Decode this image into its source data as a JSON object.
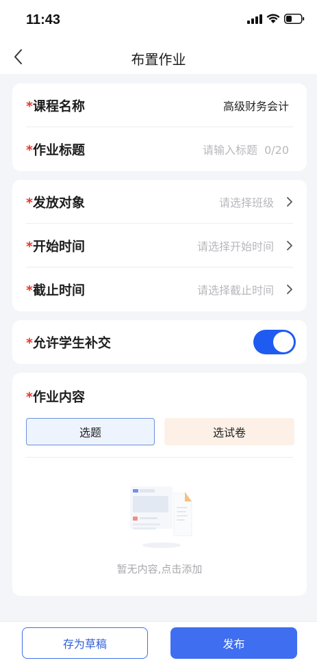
{
  "status": {
    "time": "11:43"
  },
  "nav": {
    "title": "布置作业",
    "back_icon": "chevron-left-icon"
  },
  "required_mark": "*",
  "basic": {
    "course_label": "课程名称",
    "course_value": "高级财务会计",
    "title_label": "作业标题",
    "title_placeholder": "请输入标题",
    "title_counter": "0/20"
  },
  "dispatch": {
    "target_label": "发放对象",
    "target_placeholder": "请选择班级",
    "start_label": "开始时间",
    "start_placeholder": "请选择开始时间",
    "end_label": "截止时间",
    "end_placeholder": "请选择截止时间"
  },
  "late": {
    "label": "允许学生补交",
    "enabled": true
  },
  "content": {
    "label": "作业内容",
    "tabs": [
      "选题",
      "选试卷"
    ],
    "selected_tab": "选题",
    "empty_text": "暂无内容,点击添加"
  },
  "actions": {
    "draft_label": "存为草稿",
    "publish_label": "发布"
  },
  "colors": {
    "accent": "#3f6ff0",
    "toggle_on": "#1f5bf0",
    "required": "#e5352b",
    "tab_selected_bg": "#eef4fd",
    "tab_paper_bg": "#fdf1e7"
  }
}
